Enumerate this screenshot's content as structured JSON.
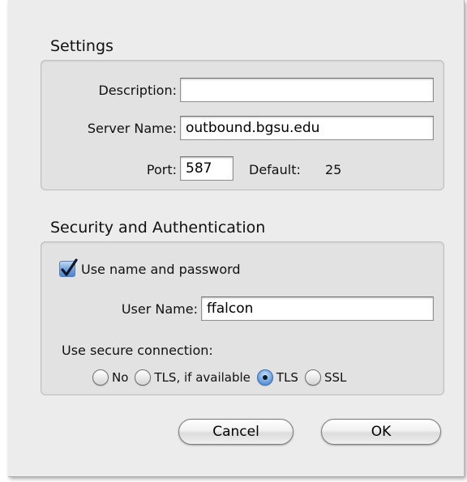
{
  "settings": {
    "title": "Settings",
    "description_label": "Description:",
    "description_value": "",
    "server_name_label": "Server Name:",
    "server_name_value": "outbound.bgsu.edu",
    "port_label": "Port:",
    "port_value": "587",
    "default_label": "Default:",
    "default_value": "25"
  },
  "security": {
    "title": "Security and Authentication",
    "use_name_password_label": "Use name and password",
    "use_name_password_checked": true,
    "user_name_label": "User Name:",
    "user_name_value": "ffalcon",
    "secure_connection_label": "Use secure connection:",
    "options": [
      {
        "label": "No",
        "selected": false
      },
      {
        "label": "TLS, if available",
        "selected": false
      },
      {
        "label": "TLS",
        "selected": true
      },
      {
        "label": "SSL",
        "selected": false
      }
    ]
  },
  "buttons": {
    "cancel": "Cancel",
    "ok": "OK"
  },
  "colors": {
    "accent": "#4b86d0",
    "dialog_bg": "#ececec",
    "group_bg": "#e2e2e2"
  }
}
